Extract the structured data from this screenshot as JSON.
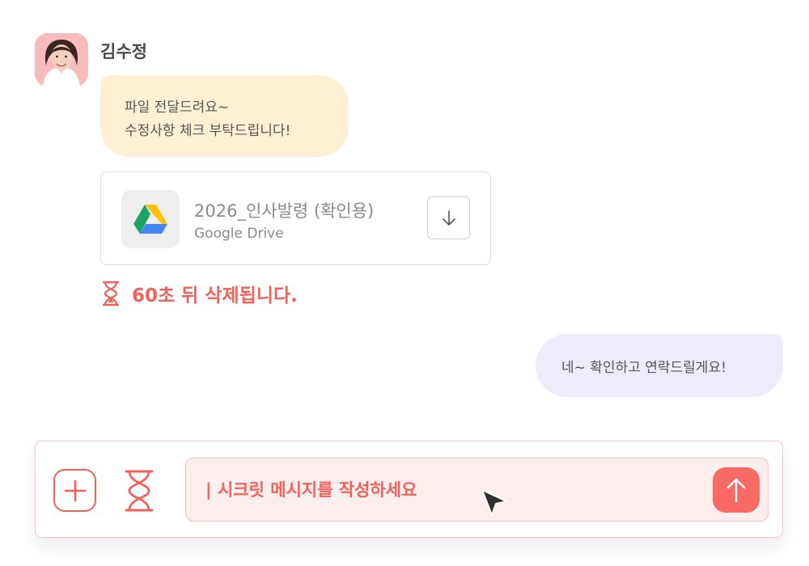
{
  "chat": {
    "sender_name": "김수정",
    "incoming_message": {
      "line1": "파일 전달드려요~",
      "line2": "수정사항 체크 부탁드립니다!"
    },
    "file": {
      "name": "2026_인사발령 (확인용)",
      "source": "Google Drive",
      "icon": "google-drive-icon"
    },
    "expire_notice": "60초 뒤 삭제됩니다.",
    "outgoing_message": "네~ 확인하고 연락드릴게요!"
  },
  "composer": {
    "input_value": "| 시크릿 메시지를 작성하세요",
    "icons": {
      "add": "plus-icon",
      "timer": "hourglass-icon",
      "send": "arrow-up-icon"
    }
  },
  "colors": {
    "accent": "#f0625c",
    "incoming_bubble": "#fff0d4",
    "outgoing_bubble": "#ececfc",
    "input_background": "#fdeeee"
  }
}
